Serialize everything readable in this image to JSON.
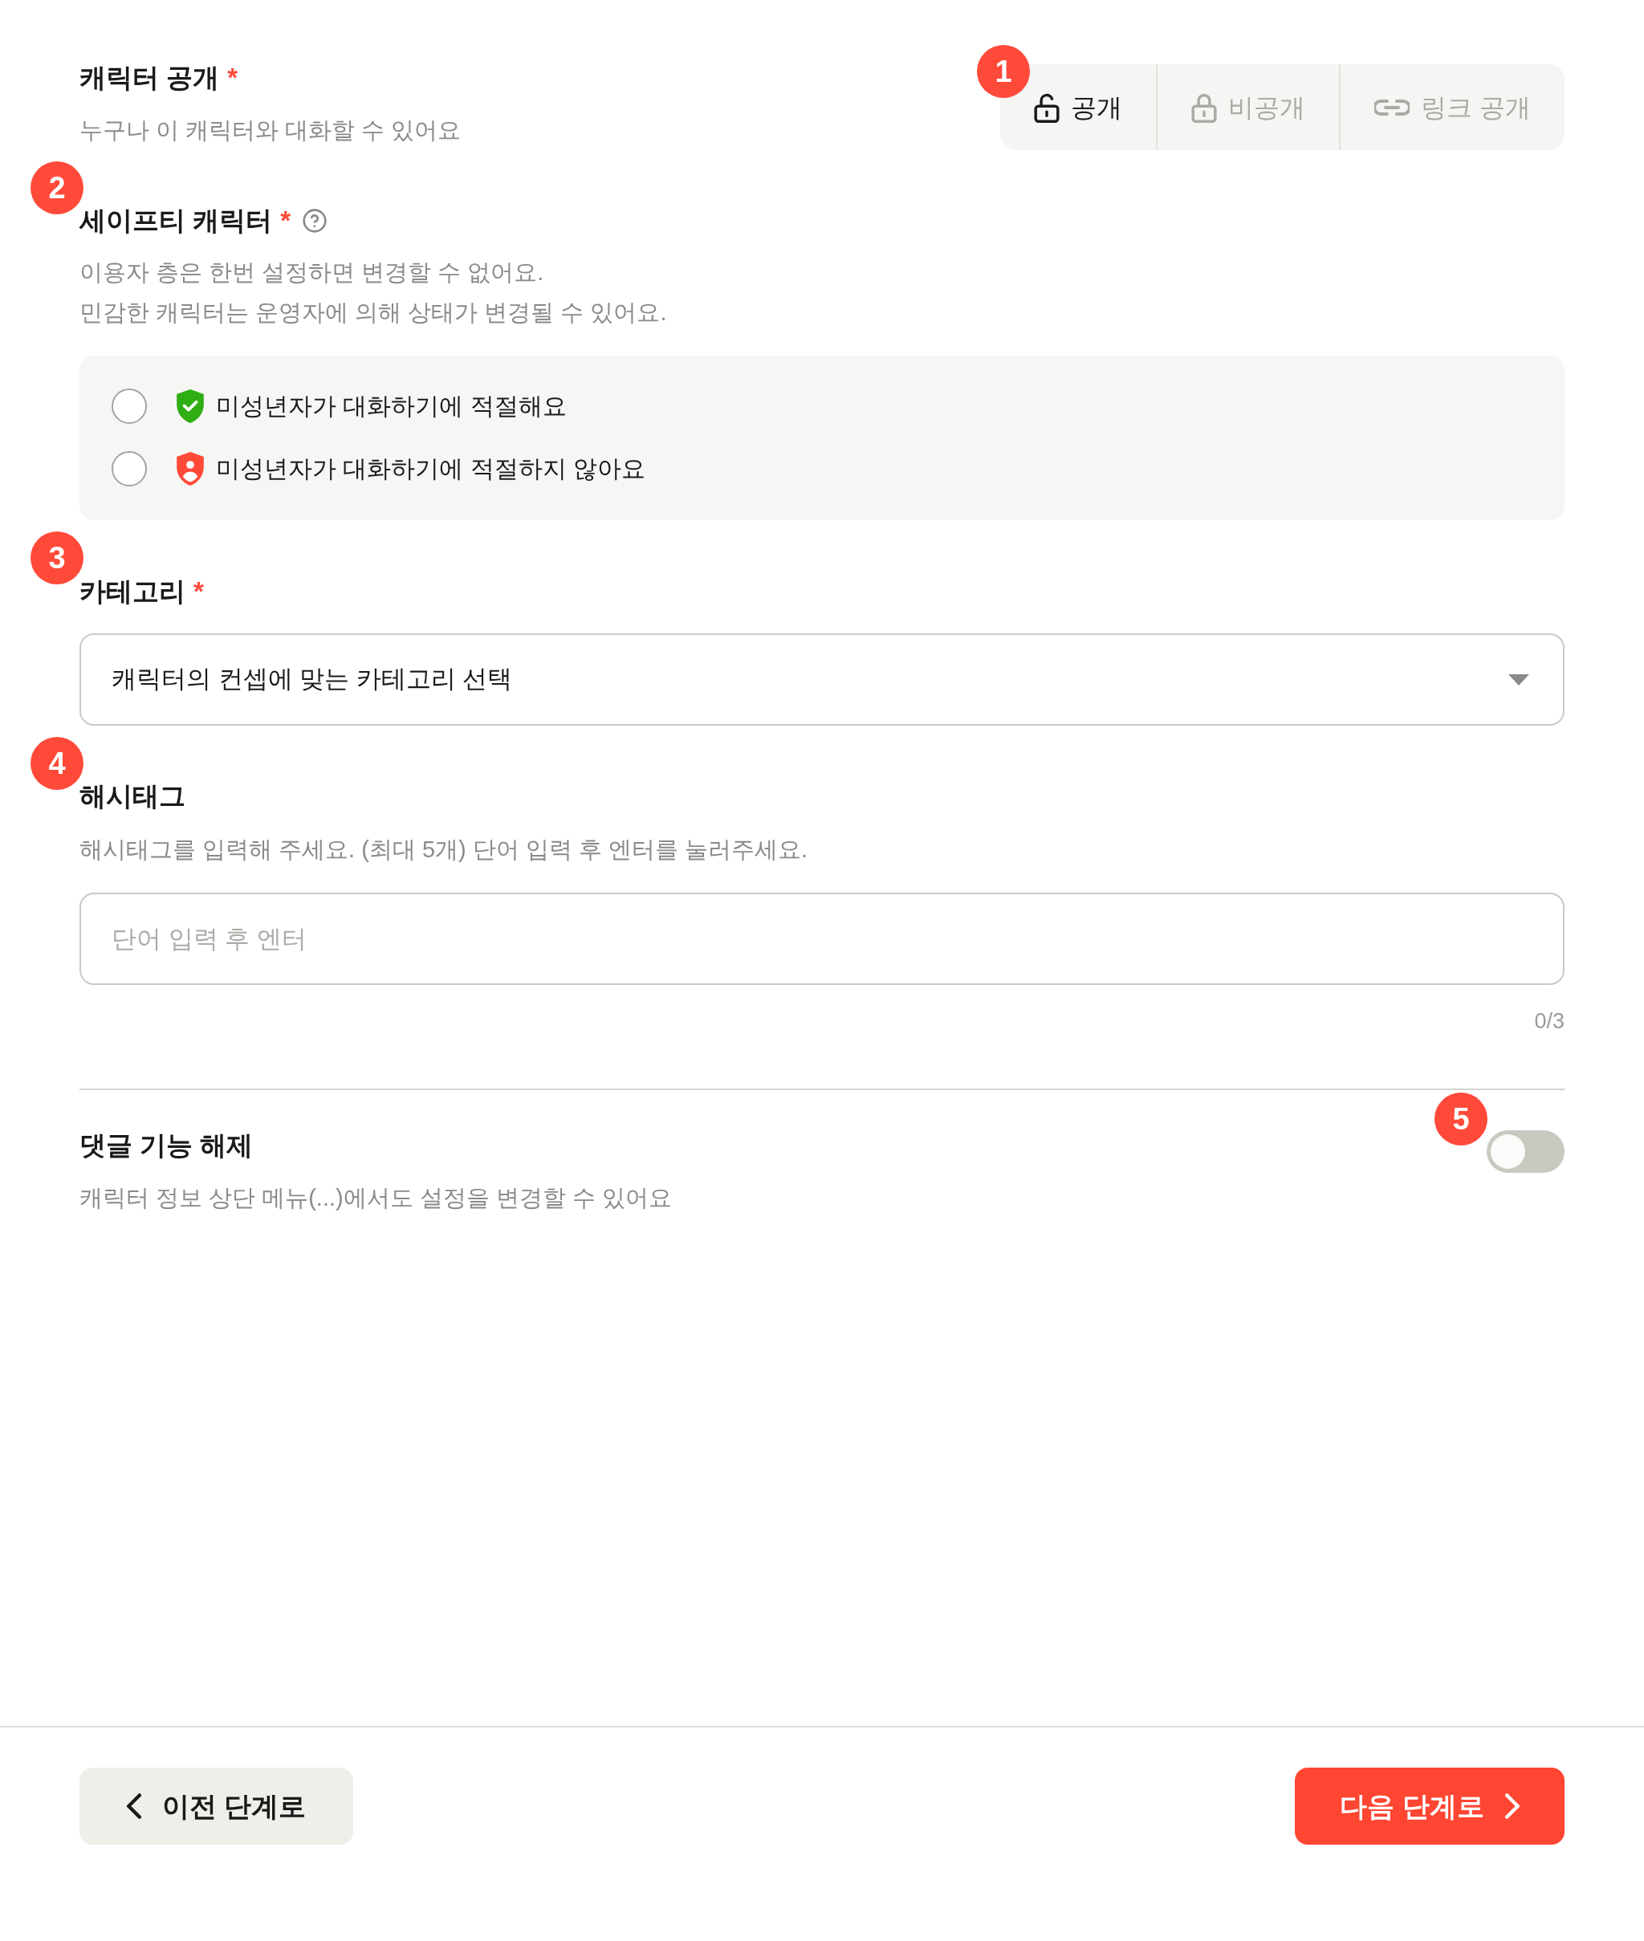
{
  "visibility": {
    "marker": "1",
    "title": "캐릭터 공개",
    "required_mark": "*",
    "description": "누구나 이 캐릭터와 대화할 수 있어요",
    "options": [
      {
        "kind": "public",
        "label": "공개",
        "selected": true
      },
      {
        "kind": "private",
        "label": "비공개",
        "selected": false
      },
      {
        "kind": "link",
        "label": "링크 공개",
        "selected": false
      }
    ]
  },
  "safety": {
    "marker": "2",
    "title": "세이프티 캐릭터",
    "required_mark": "*",
    "description": [
      "이용자 층은 한번 설정하면 변경할 수 없어요.",
      "민감한 캐릭터는 운영자에 의해 상태가 변경될 수 있어요."
    ],
    "options": [
      {
        "kind": "suitable",
        "label": "미성년자가 대화하기에 적절해요",
        "selected": false
      },
      {
        "kind": "unsuitable",
        "label": "미성년자가 대화하기에 적절하지 않아요",
        "selected": false
      }
    ]
  },
  "category": {
    "marker": "3",
    "title": "카테고리",
    "required_mark": "*",
    "select": {
      "value": "캐릭터의 컨셉에 맞는 카테고리 선택"
    }
  },
  "hashtags": {
    "marker": "4",
    "title": "해시태그",
    "description": "해시태그를 입력해 주세요. (최대 5개) 단어 입력 후 엔터를 눌러주세요.",
    "input": {
      "placeholder": "단어 입력 후 엔터"
    },
    "counter": "0/3"
  },
  "comments": {
    "marker": "5",
    "title": "댓글 기능 해제",
    "description": "캐릭터 정보 상단 메뉴(...)에서도 설정을 변경할 수 있어요",
    "toggle": {
      "on": false
    }
  },
  "footer": {
    "buttons": [
      {
        "kind": "back",
        "label": "이전 단계로"
      },
      {
        "kind": "next",
        "label": "다음 단계로"
      }
    ]
  }
}
